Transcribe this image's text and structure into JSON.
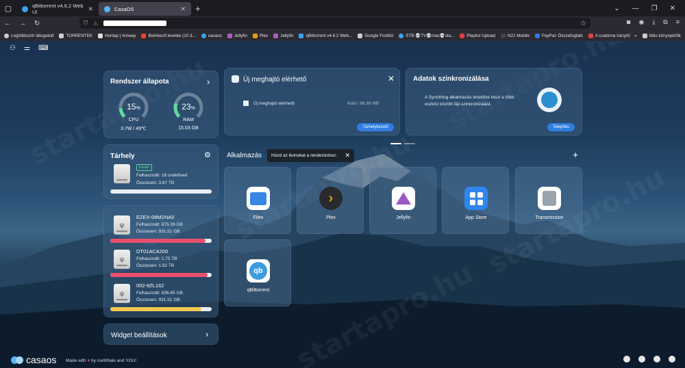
{
  "browser": {
    "tabs": [
      {
        "title": "qBittorrent v4.6.2 Web UI",
        "icon": "qbittorrent-favicon",
        "active": false
      },
      {
        "title": "CasaOS",
        "icon": "casaos-favicon",
        "active": true
      }
    ],
    "new_tab": "+",
    "bookmarks": [
      {
        "label": "Legtöbbször látogatott",
        "icon": "gear-icon",
        "color": "#cccccc"
      },
      {
        "label": "TORRENTEK",
        "icon": "folder-icon",
        "color": "#cccccc"
      },
      {
        "label": "Honlap | Amway",
        "icon": "amway-icon",
        "color": "#dddddd"
      },
      {
        "label": "Beérkező levelek (10 3...",
        "icon": "gmail-icon",
        "color": "#ea4335"
      },
      {
        "label": "casaos",
        "icon": "casaos-icon",
        "color": "#3aa4ea"
      },
      {
        "label": "Jellyfin",
        "icon": "jellyfin-icon",
        "color": "#aa5cc3"
      },
      {
        "label": "Plex",
        "icon": "plex-icon",
        "color": "#e5a00d"
      },
      {
        "label": "Jellyfin",
        "icon": "jellyfin-icon",
        "color": "#aa5cc3"
      },
      {
        "label": "qBittorrent v4.6.2 Web...",
        "icon": "qbittorrent-icon",
        "color": "#3aa4ea"
      },
      {
        "label": "Google Fordító",
        "icon": "folder-icon",
        "color": "#cccccc"
      },
      {
        "label": "STB 💀TV💀mac💀sta...",
        "icon": "stb-icon",
        "color": "#3aa4ea"
      },
      {
        "label": "Playlist Upload",
        "icon": "playlist-icon",
        "color": "#e04040"
      },
      {
        "label": "N21 Mobile",
        "icon": "n21-icon",
        "color": "#444444"
      },
      {
        "label": "PayPal: Összefoglaló",
        "icon": "paypal-icon",
        "color": "#2a7bd8"
      },
      {
        "label": "A csatorna irányítópul...",
        "icon": "youtube-icon",
        "color": "#e04040"
      }
    ],
    "bookmarks_more": "»",
    "other_bookmarks": "Más könyvjelzők"
  },
  "system": {
    "title": "Rendszer állapota",
    "cpu": {
      "percent": 15,
      "unit": "%",
      "label": "CPU",
      "detail": "3.7W / 49℃"
    },
    "ram": {
      "percent": 23,
      "unit": "%",
      "label": "RAM",
      "detail": "15.03 GB"
    }
  },
  "storage": {
    "title": "Tárhely",
    "badge": "Kiváló",
    "used": "Felhasznált: 16 undefined",
    "total": "Összesen: 3.87 TB",
    "usage_fraction": 0.004
  },
  "drives": [
    {
      "name": "EZEX-08M2NA0",
      "used": "Felhasznált: 875.39 GB",
      "total": "Összesen: 931.51 GB",
      "fraction": 0.94,
      "color": "#e8506a"
    },
    {
      "name": "DT01ACA200",
      "used": "Felhasznált: 1.75 TB",
      "total": "Összesen: 1.82 TB",
      "fraction": 0.96,
      "color": "#e8506a"
    },
    {
      "name": "002-9ZL162",
      "used": "Felhasznált: 836.85 GB",
      "total": "Összesen: 931.51 GB",
      "fraction": 0.9,
      "color": "#f2c74f"
    }
  ],
  "widget_settings": "Widget beállítások",
  "new_drive": {
    "title": "Új meghajtó elérhető",
    "item": "Új meghajtó elérhető",
    "size": "NaN / 86.89 MB",
    "button": "Tárhelykezelő"
  },
  "sync": {
    "title": "Adatok szinkronizálása",
    "text": "A Syncthing alkalmazás lehetővé teszi a több eszköz közötti fájl-szinkronizálást.",
    "button": "Telepítés"
  },
  "apps": {
    "title": "Alkalmazás",
    "tooltip": "Húzd az ikonokat a rendezéshez.",
    "add": "+",
    "items": [
      {
        "name": "Files",
        "icon": "files-icon"
      },
      {
        "name": "Plex",
        "icon": "plex-icon"
      },
      {
        "name": "Jellyfin",
        "icon": "jellyfin-icon"
      },
      {
        "name": "App Store",
        "icon": "app-store-icon"
      },
      {
        "name": "Transmission",
        "icon": "transmission-icon"
      },
      {
        "name": "qBittorrent",
        "icon": "qbittorrent-icon"
      }
    ]
  },
  "footer": {
    "logo": "casaos",
    "made_with": "Made with",
    "by": "by IceWhale and YOU!"
  }
}
